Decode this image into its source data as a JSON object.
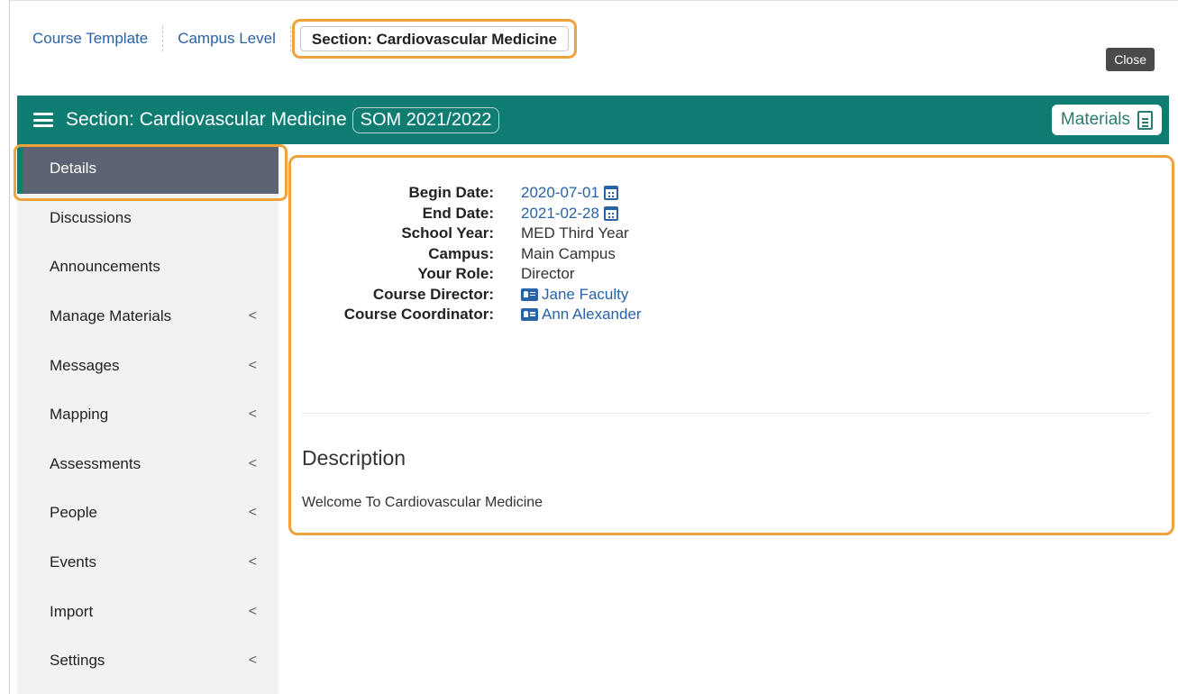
{
  "breadcrumbs": [
    {
      "label": "Course Template"
    },
    {
      "label": "Campus Level"
    },
    {
      "label": "Section: Cardiovascular Medicine"
    }
  ],
  "close_label": "Close",
  "header": {
    "title": "Section: Cardiovascular Medicine",
    "term": "SOM 2021/2022",
    "materials_label": "Materials"
  },
  "sidebar": {
    "items": [
      {
        "label": "Details",
        "expandable": false
      },
      {
        "label": "Discussions",
        "expandable": false
      },
      {
        "label": "Announcements",
        "expandable": false
      },
      {
        "label": "Manage Materials",
        "expandable": true
      },
      {
        "label": "Messages",
        "expandable": true
      },
      {
        "label": "Mapping",
        "expandable": true
      },
      {
        "label": "Assessments",
        "expandable": true
      },
      {
        "label": "People",
        "expandable": true
      },
      {
        "label": "Events",
        "expandable": true
      },
      {
        "label": "Import",
        "expandable": true
      },
      {
        "label": "Settings",
        "expandable": true
      }
    ],
    "chevron": "<"
  },
  "details": {
    "begin_date_label": "Begin Date:",
    "begin_date": "2020-07-01",
    "end_date_label": "End Date:",
    "end_date": "2021-02-28",
    "school_year_label": "School Year:",
    "school_year": "MED Third Year",
    "campus_label": "Campus:",
    "campus": "Main Campus",
    "role_label": "Your Role:",
    "role": "Director",
    "director_label": "Course Director:",
    "director": "Jane Faculty",
    "coordinator_label": "Course Coordinator:",
    "coordinator": "Ann Alexander"
  },
  "description": {
    "title": "Description",
    "body": "Welcome To Cardiovascular Medicine"
  },
  "colors": {
    "header_teal": "#0f7d72",
    "highlight_orange": "#f0a23a",
    "link_blue": "#2a62a6",
    "active_item_bg": "#5c6473"
  }
}
